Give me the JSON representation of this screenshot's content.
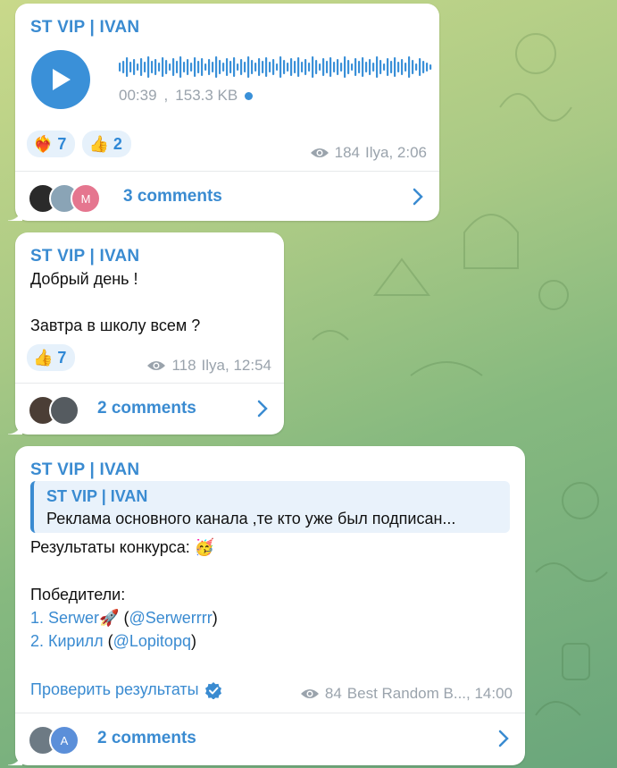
{
  "messages": [
    {
      "sender": "ST VIP | IVAN",
      "audio": {
        "duration": "00:39",
        "size": "153.3 KB"
      },
      "reactions": [
        {
          "emoji": "❤️‍🔥",
          "count": "7"
        },
        {
          "emoji": "👍",
          "count": "2"
        }
      ],
      "views": "184",
      "author_time": "Ilya, 2:06",
      "comments": "3 comments",
      "avatars": [
        "",
        "",
        "M"
      ]
    },
    {
      "sender": "ST VIP | IVAN",
      "lines": [
        "Добрый день !",
        "Завтра в школу всем ?"
      ],
      "reactions": [
        {
          "emoji": "👍",
          "count": "7"
        }
      ],
      "views": "118",
      "author_time": "Ilya, 12:54",
      "comments": "2 comments"
    },
    {
      "sender": "ST VIP | IVAN",
      "reply": {
        "title": "ST VIP | IVAN",
        "text": "Реклама основного канала ,те кто уже был подписан..."
      },
      "results_label": "Результаты конкурса:",
      "results_emoji": "🥳",
      "winners_label": "Победители:",
      "winners": [
        {
          "prefix": "1. Serwer",
          "emoji": "🚀",
          "handle": "@Serwerrrr"
        },
        {
          "prefix": "2. Кирилл",
          "emoji": "",
          "handle": "@Lopitopq"
        }
      ],
      "check_label": "Проверить результаты",
      "views": "84",
      "author_time": "Best Random B..., 14:00",
      "comments": "2 comments",
      "avatars": [
        "",
        "A"
      ]
    }
  ]
}
